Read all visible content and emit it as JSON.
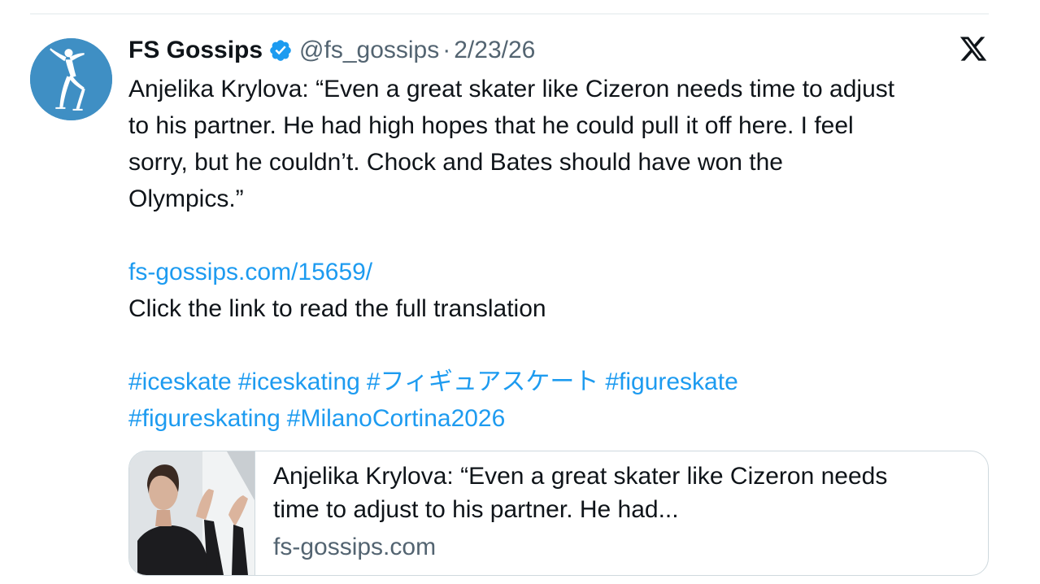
{
  "tweet": {
    "display_name": "FS Gossips",
    "handle": "@fs_gossips",
    "separator": "·",
    "date": "2/23/26",
    "text_lines": [
      "Anjelika Krylova: “Even a great skater like Cizeron needs time to adjust",
      "to his partner. He had high hopes that he could pull it off here. I feel",
      "sorry, but he couldn’t. Chock and Bates should have won the",
      "Olympics.”"
    ],
    "link": "fs-gossips.com/15659/",
    "link_caption": "Click the link to read the full translation",
    "hashtags": [
      "#iceskate",
      "#iceskating",
      "#フィギュアスケート",
      "#figureskate",
      "#figureskating",
      "#MilanoCortina2026"
    ]
  },
  "card": {
    "title_line1": "Anjelika Krylova: “Even a great skater like Cizeron needs",
    "title_line2": "time to adjust to his partner. He had...",
    "domain": "fs-gossips.com"
  },
  "icons": {
    "avatar": "figure-skater-silhouette-icon",
    "verified": "verified-badge-icon",
    "brand": "x-logo-icon"
  },
  "colors": {
    "link": "#1d9bf0",
    "secondary_text": "#536471",
    "primary_text": "#0f1419",
    "avatar_bg": "#3f8fc4",
    "divider": "#eff3f4",
    "card_border": "#cfd9de"
  }
}
